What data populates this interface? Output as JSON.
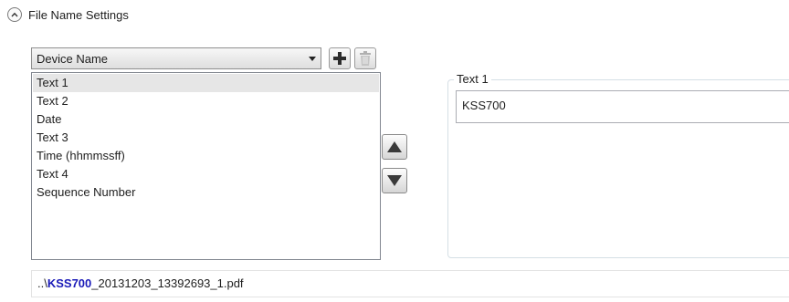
{
  "section": {
    "title": "File Name Settings"
  },
  "combo": {
    "selected": "Device Name"
  },
  "list": {
    "items": [
      "Text 1",
      "Text 2",
      "Date",
      "Text 3",
      "Time (hhmmssff)",
      "Text 4",
      "Sequence Number"
    ],
    "selected_index": 0
  },
  "group": {
    "legend": "Text 1",
    "value": "KSS700"
  },
  "preview": {
    "prefix": "..\\",
    "highlight": "KSS700",
    "suffix": "_20131203_13392693_1.pdf"
  },
  "colors": {
    "highlight": "#1a1ab8",
    "selection": "#e6e6e6",
    "add_icon": "#2b2b2b"
  },
  "icons": {
    "collapse": "chevron-up-icon",
    "add": "plus-icon",
    "delete": "trash-icon",
    "up": "triangle-up-icon",
    "down": "triangle-down-icon",
    "dropdown": "chevron-down-icon"
  }
}
